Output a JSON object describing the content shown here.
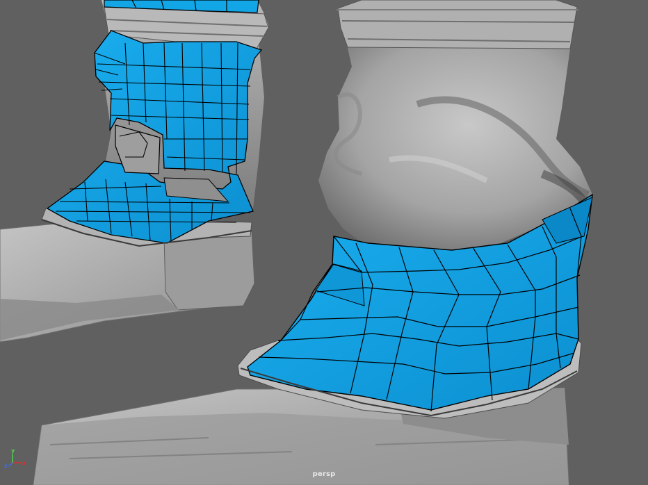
{
  "viewport": {
    "camera_label": "persp",
    "axis": {
      "x_label": "x",
      "y_label": "y",
      "z_label": "z"
    },
    "colors": {
      "background": "#606060",
      "selected_faces": "#12a6e6",
      "mesh_gray": "#a9a9a9",
      "wire": "#000000",
      "axis_x": "#e0302a",
      "axis_y": "#4fd34f",
      "axis_z": "#3f6ee0"
    }
  }
}
